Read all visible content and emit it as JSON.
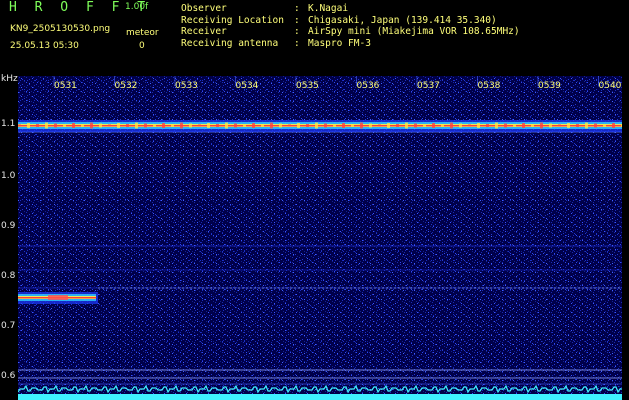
{
  "app": {
    "title": "H R O F F T",
    "version": "1.00f",
    "filename": "KN9_2505130530.png",
    "datetime": "25.05.13 05:30",
    "meteor_label": "meteor",
    "meteor_count": "0"
  },
  "info": [
    {
      "key": "Observer",
      "value": "K.Nagai"
    },
    {
      "key": "Receiving Location",
      "value": "Chigasaki, Japan (139.414 35.340)"
    },
    {
      "key": "Receiver",
      "value": "AirSpy mini (Miakejima VOR 108.65MHz)"
    },
    {
      "key": "Receiving antenna",
      "value": "Maspro FM-3"
    }
  ],
  "axis": {
    "y_unit": "kHz",
    "time_labels": [
      "0531",
      "0532",
      "0533",
      "0534",
      "0535",
      "0536",
      "0537",
      "0538",
      "0539",
      "0540"
    ],
    "freq_labels": [
      "1.1",
      "1.0",
      "0.9",
      "0.8",
      "0.7",
      "0.6"
    ]
  },
  "colors": {
    "background": "#00004a",
    "header_text": "#ffff7a",
    "title_text": "#7fff5a",
    "noise_floor": "#3ff2ff"
  }
}
